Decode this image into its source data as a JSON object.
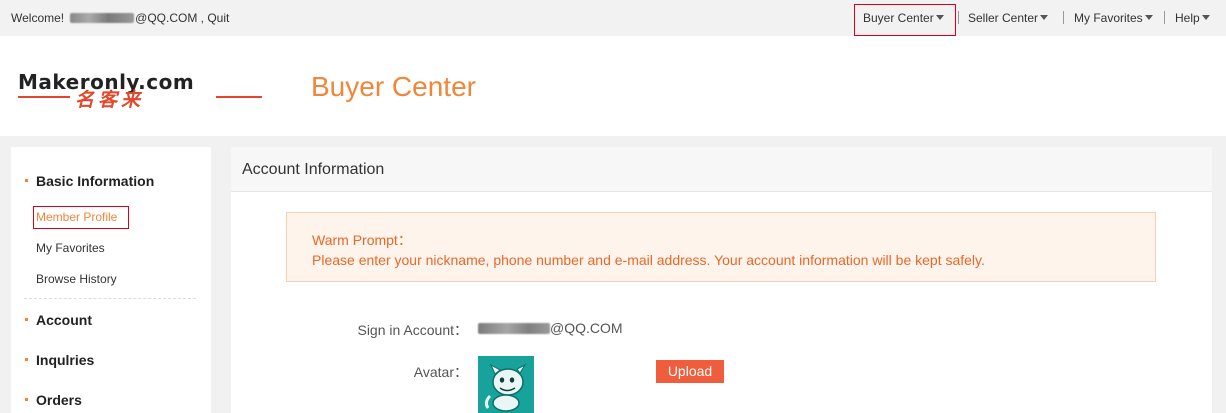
{
  "topbar": {
    "welcome_prefix": "Welcome!",
    "welcome_suffix": "@QQ.COM ,",
    "quit_label": "Quit",
    "nav": [
      {
        "label": "Buyer Center"
      },
      {
        "label": "Seller Center"
      },
      {
        "label": "My Favorites"
      },
      {
        "label": "Help"
      }
    ]
  },
  "header": {
    "logo_text": "Makeronly.com",
    "logo_cn": "名客来",
    "page_title": "Buyer Center"
  },
  "sidebar": {
    "sections": [
      {
        "label": "Basic Information",
        "items": [
          "Member Profile",
          "My Favorites",
          "Browse History"
        ]
      },
      {
        "label": "Account"
      },
      {
        "label": "Inqulries"
      },
      {
        "label": "Orders"
      }
    ],
    "active_item": "Member Profile"
  },
  "main": {
    "title": "Account Information",
    "prompt_title": "Warm Prompt：",
    "prompt_text": "Please enter your nickname, phone number and e-mail address. Your account information will be kept safely.",
    "sign_in_label": "Sign in Account：",
    "sign_in_value_suffix": "@QQ.COM",
    "avatar_label": "Avatar：",
    "upload_label": "Upload"
  },
  "colors": {
    "accent_orange": "#f0863a",
    "prompt_text": "#e8682a",
    "upload_button": "#f05d3c",
    "highlight_box": "#d9001b"
  },
  "icons": [
    "caret-down-icon",
    "avatar-image"
  ]
}
